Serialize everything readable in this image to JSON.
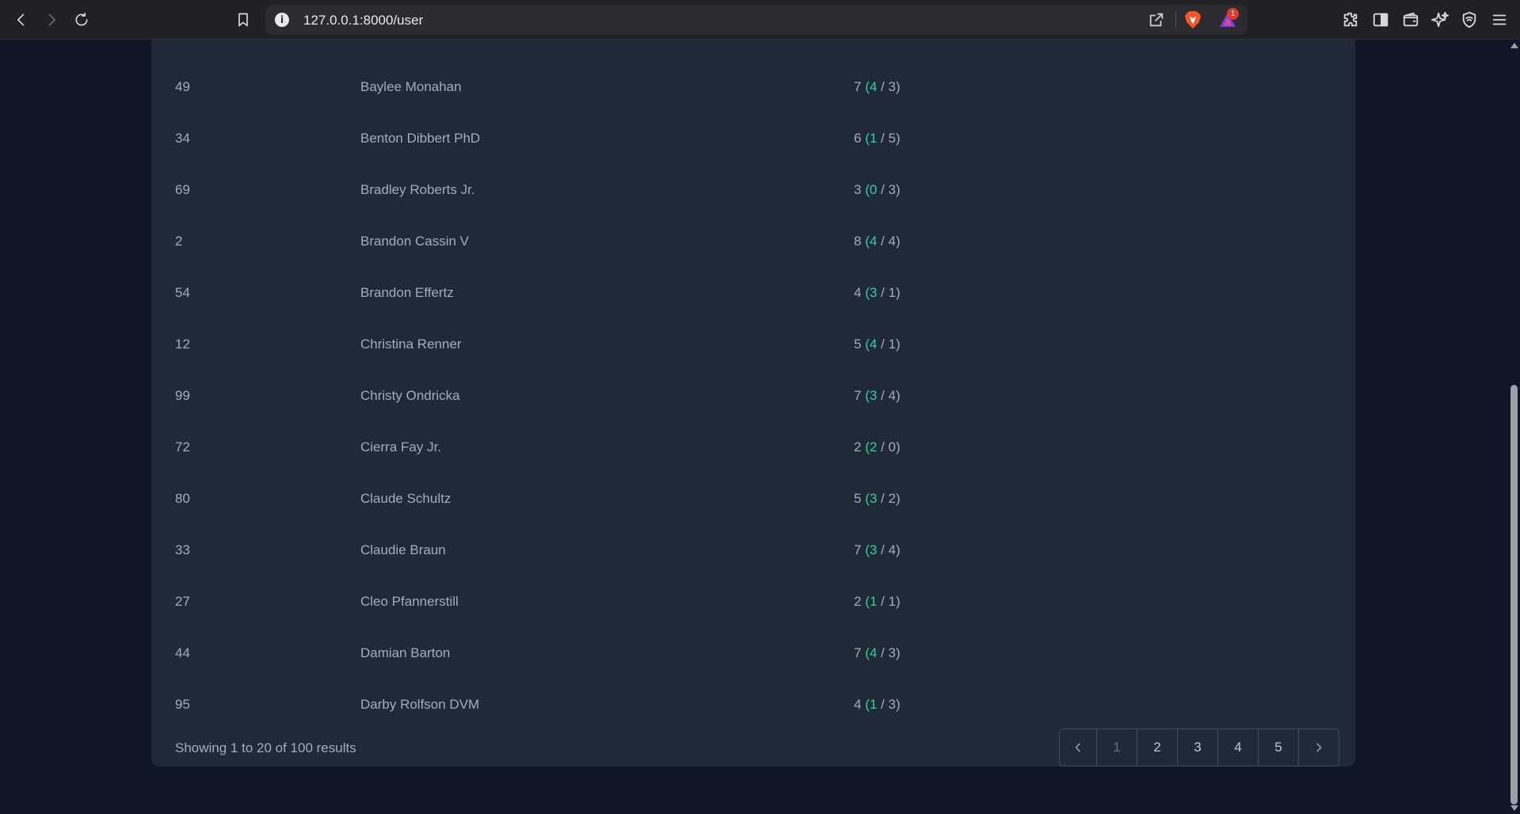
{
  "browser": {
    "url": "127.0.0.1:8000/user",
    "info_glyph": "i",
    "rewards_badge": "1",
    "icons": [
      "back-icon",
      "forward-icon",
      "reload-icon",
      "bookmark-icon",
      "share-icon",
      "brave-shields-icon",
      "brave-rewards-icon",
      "extensions-icon",
      "sidebar-icon",
      "wallet-icon",
      "leo-ai-icon",
      "vpn-icon",
      "menu-icon"
    ]
  },
  "table": {
    "rows": [
      {
        "id": "49",
        "name": "Baylee Monahan",
        "total": "7",
        "a": "4",
        "b": "3"
      },
      {
        "id": "34",
        "name": "Benton Dibbert PhD",
        "total": "6",
        "a": "1",
        "b": "5"
      },
      {
        "id": "69",
        "name": "Bradley Roberts Jr.",
        "total": "3",
        "a": "0",
        "b": "3"
      },
      {
        "id": "2",
        "name": "Brandon Cassin V",
        "total": "8",
        "a": "4",
        "b": "4"
      },
      {
        "id": "54",
        "name": "Brandon Effertz",
        "total": "4",
        "a": "3",
        "b": "1"
      },
      {
        "id": "12",
        "name": "Christina Renner",
        "total": "5",
        "a": "4",
        "b": "1"
      },
      {
        "id": "99",
        "name": "Christy Ondricka",
        "total": "7",
        "a": "3",
        "b": "4"
      },
      {
        "id": "72",
        "name": "Cierra Fay Jr.",
        "total": "2",
        "a": "2",
        "b": "0"
      },
      {
        "id": "80",
        "name": "Claude Schultz",
        "total": "5",
        "a": "3",
        "b": "2"
      },
      {
        "id": "33",
        "name": "Claudie Braun",
        "total": "7",
        "a": "3",
        "b": "4"
      },
      {
        "id": "27",
        "name": "Cleo Pfannerstill",
        "total": "2",
        "a": "1",
        "b": "1"
      },
      {
        "id": "44",
        "name": "Damian Barton",
        "total": "7",
        "a": "4",
        "b": "3"
      },
      {
        "id": "95",
        "name": "Darby Rolfson DVM",
        "total": "4",
        "a": "1",
        "b": "3"
      }
    ]
  },
  "footer": {
    "summary": "Showing 1 to 20 of 100 results",
    "pages": [
      "1",
      "2",
      "3",
      "4",
      "5"
    ],
    "current_page": "1"
  },
  "colors": {
    "page_bg": "#0f1626",
    "card_bg": "#1f2937",
    "text": "#a4acb9",
    "accent_green": "#34d399"
  }
}
